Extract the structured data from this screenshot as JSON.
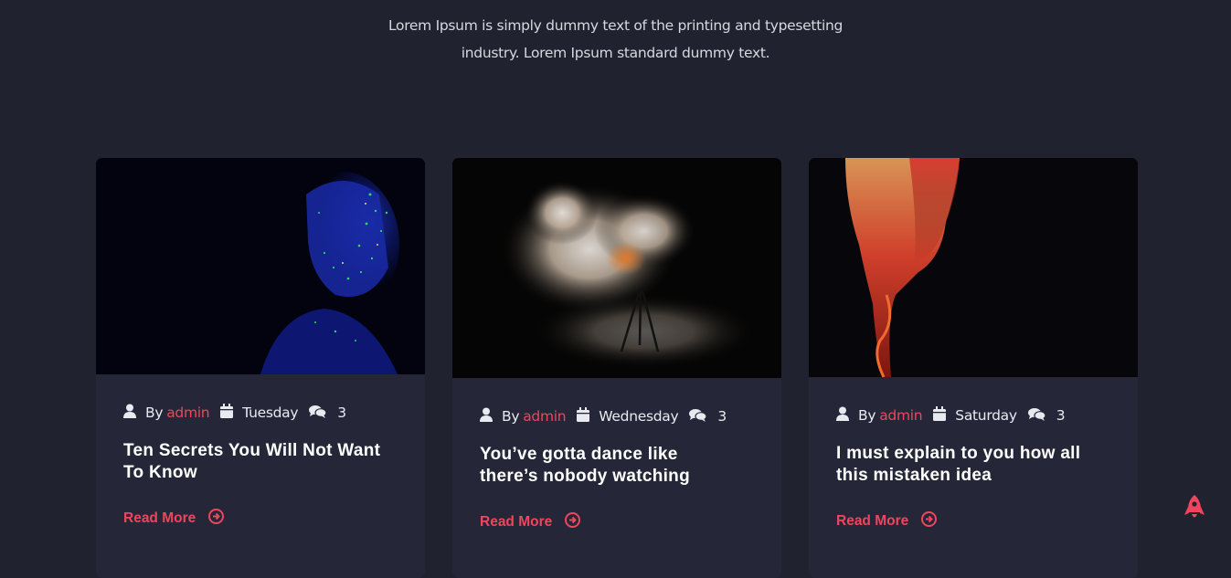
{
  "intro": {
    "line1": "Lorem Ipsum is simply dummy text of the printing and typesetting",
    "line2": "industry. Lorem Ipsum standard dummy text."
  },
  "posts": [
    {
      "by": "By",
      "author": "admin",
      "day": "Tuesday",
      "comments": "3",
      "title_line1": "Ten Secrets You Will Not Want",
      "title_line2": "To Know",
      "read_more": "Read More",
      "image": "glitter-face-photo"
    },
    {
      "by": "By",
      "author": "admin",
      "day": "Wednesday",
      "comments": "3",
      "title_line1": "You’ve gotta dance like",
      "title_line2": "there’s nobody watching",
      "read_more": "Read More",
      "image": "smoke-explosion-photo"
    },
    {
      "by": "By",
      "author": "admin",
      "day": "Saturday",
      "comments": "3",
      "title_line1": "I must explain to you how all",
      "title_line2": "this mistaken idea",
      "read_more": "Read More",
      "image": "red-smoke-photo"
    }
  ],
  "colors": {
    "accent": "#f0455c",
    "background": "#20222f",
    "card": "#252739"
  },
  "icons": {
    "author": "user-icon",
    "date": "calendar-icon",
    "comments": "comments-icon",
    "read_more": "arrow-circle-right-icon",
    "scroll_top": "rocket-icon"
  }
}
